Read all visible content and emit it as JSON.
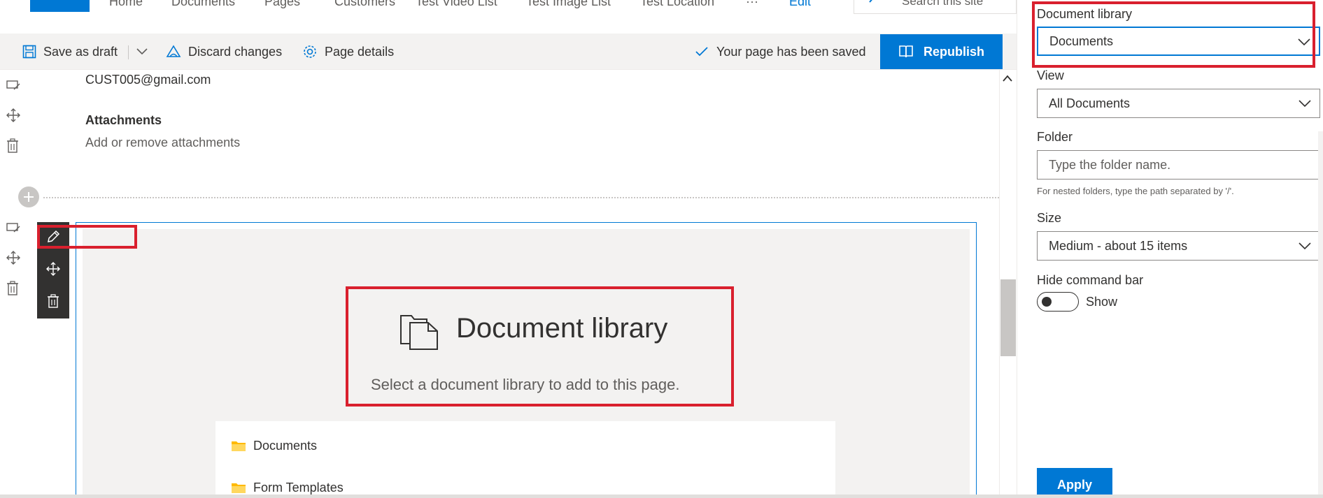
{
  "nav": {
    "items": [
      "Home",
      "Documents",
      "Pages",
      "Customers",
      "Test Video List",
      "Test Image List",
      "Test Location"
    ],
    "more": "···",
    "edit": "Edit",
    "search_placeholder": "Search this site"
  },
  "toolbar": {
    "save_draft": "Save as draft",
    "discard": "Discard changes",
    "page_details": "Page details",
    "saved_status": "Your page has been saved",
    "republish": "Republish"
  },
  "content": {
    "email": "CUST005@gmail.com",
    "attachments_title": "Attachments",
    "attachments_sub": "Add or remove attachments"
  },
  "webpart": {
    "title": "Document library",
    "subtitle": "Select a document library to add to this page.",
    "libraries": [
      "Documents",
      "Form Templates"
    ]
  },
  "pane": {
    "library_label": "Document library",
    "library_value": "Documents",
    "view_label": "View",
    "view_value": "All Documents",
    "folder_label": "Folder",
    "folder_placeholder": "Type the folder name.",
    "folder_hint": "For nested folders, type the path separated by '/'.",
    "size_label": "Size",
    "size_value": "Medium - about 15 items",
    "hide_cmd_label": "Hide command bar",
    "toggle_label": "Show",
    "apply": "Apply"
  },
  "colors": {
    "accent": "#0078d4",
    "highlight": "#d9202e"
  }
}
